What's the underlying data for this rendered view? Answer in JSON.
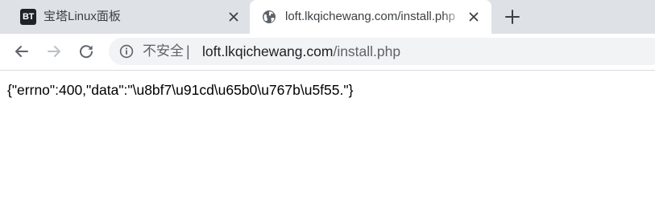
{
  "tabs": [
    {
      "title": "宝塔Linux面板",
      "favicon_text": "BT",
      "favicon_icon": "bt-panel-icon",
      "active": false
    },
    {
      "title": "loft.lkqichewang.com/install.php",
      "favicon_icon": "globe-icon",
      "active": true
    }
  ],
  "toolbar": {
    "back_icon": "back-arrow-icon",
    "forward_icon": "forward-arrow-icon",
    "reload_icon": "reload-icon",
    "new_tab_icon": "plus-icon"
  },
  "omnibox": {
    "security_icon": "info-icon",
    "security_label": "不安全",
    "separator": "|",
    "url_host": "loft.lkqichewang.com",
    "url_path": "/install.php"
  },
  "page": {
    "body_text": "{\"errno\":400,\"data\":\"\\u8bf7\\u91cd\\u65b0\\u767b\\u5f55.\"}"
  },
  "colors": {
    "tabstrip_bg": "#dee1e6",
    "active_tab_bg": "#ffffff",
    "omnibox_bg": "#f1f3f4",
    "icon_gray": "#5f6368"
  }
}
